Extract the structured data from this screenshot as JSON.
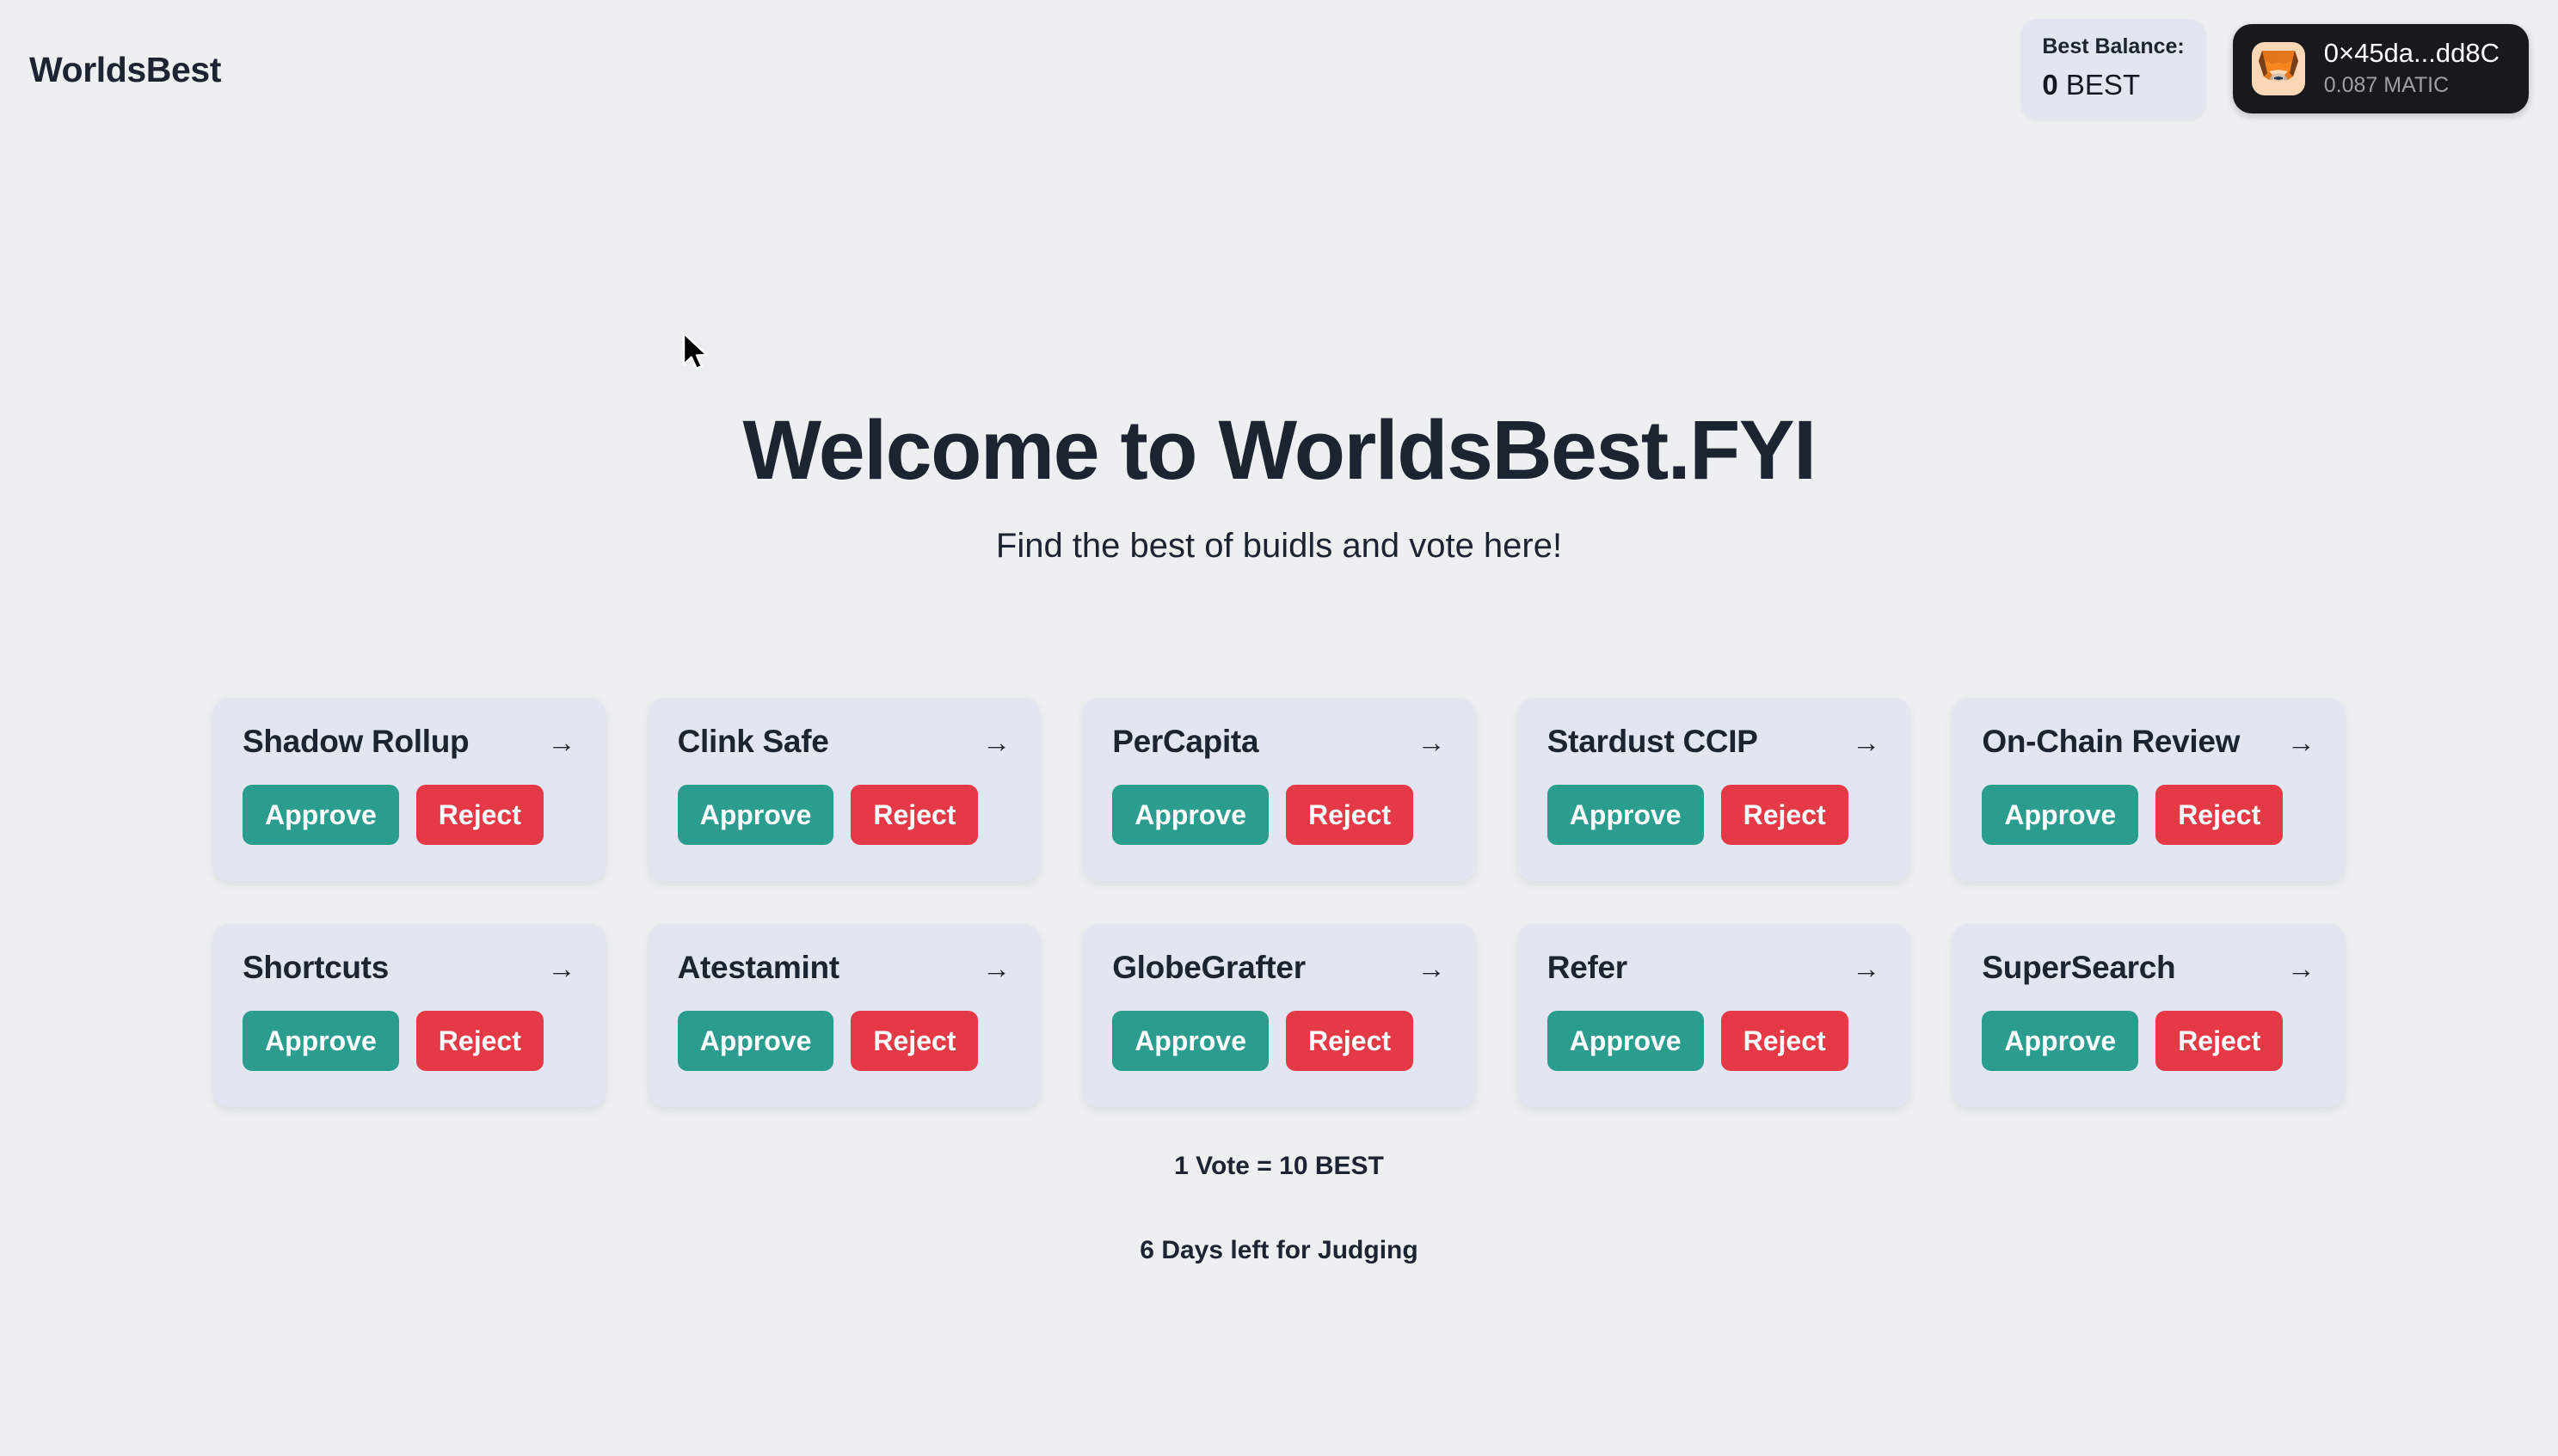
{
  "header": {
    "brand": "WorldsBest",
    "balance": {
      "label": "Best Balance:",
      "amount": "0",
      "symbol": "BEST"
    },
    "wallet": {
      "icon": "metamask-fox-icon",
      "address": "0×45da...dd8C",
      "native_balance": "0.087 MATIC"
    }
  },
  "hero": {
    "title": "Welcome to WorldsBest.FYI",
    "subtitle": "Find the best of buidls and vote here!"
  },
  "cards": {
    "approve_label": "Approve",
    "reject_label": "Reject",
    "arrow_glyph": "→",
    "items": [
      {
        "title": "Shadow Rollup"
      },
      {
        "title": "Clink Safe"
      },
      {
        "title": "PerCapita"
      },
      {
        "title": "Stardust CCIP"
      },
      {
        "title": "On-Chain Review"
      },
      {
        "title": "Shortcuts"
      },
      {
        "title": "Atestamint"
      },
      {
        "title": "GlobeGrafter"
      },
      {
        "title": "Refer"
      },
      {
        "title": "SuperSearch"
      }
    ]
  },
  "footnotes": {
    "vote_rate": "1 Vote = 10 BEST",
    "judging": "6 Days left for Judging"
  },
  "colors": {
    "page_background": "#ECF0F1",
    "card_background": "#E2E6F0",
    "approve": "#2A9D8F",
    "reject": "#E63946",
    "text": "#1B2430",
    "wallet_pill": "#17191C"
  }
}
